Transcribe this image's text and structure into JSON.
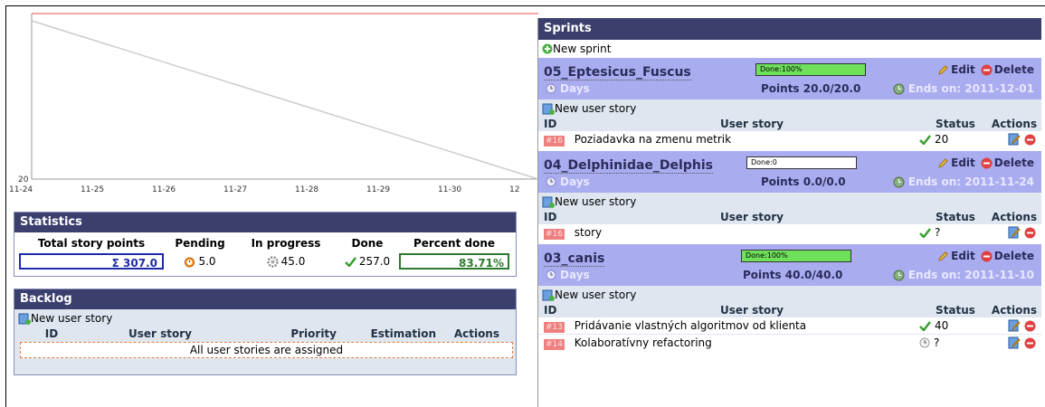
{
  "chart": {
    "x_labels": [
      "11-24",
      "11-25",
      "11-26",
      "11-27",
      "11-28",
      "11-29",
      "11-30",
      "12"
    ],
    "y_label_min": "20"
  },
  "statistics": {
    "title": "Statistics",
    "headers": [
      "Total story points",
      "Pending",
      "In progress",
      "Done",
      "Percent done"
    ],
    "total": "Σ 307.0",
    "pending": "5.0",
    "in_progress": "45.0",
    "done": "257.0",
    "percent": "83.71%"
  },
  "backlog": {
    "title": "Backlog",
    "new_user_story": "New user story",
    "headers": [
      "ID",
      "User story",
      "Priority",
      "Estimation",
      "Actions"
    ],
    "empty_message": "All user stories are assigned"
  },
  "sprints": {
    "title": "Sprints",
    "new_sprint": "New sprint",
    "items": [
      {
        "name": "05_Eptesicus_Fuscus",
        "progress_label": "Done:100%",
        "progress": 1.0,
        "edit": "Edit",
        "delete": "Delete",
        "days": "Days",
        "points": "Points 20.0/20.0",
        "ends": "Ends on: 2011-12-01",
        "new_user_story": "New user story",
        "headers": [
          "ID",
          "User story",
          "Status",
          "Actions"
        ],
        "stories": [
          {
            "id": "#16",
            "title": "Poziadavka na zmenu metrik",
            "status": "20",
            "status_icon": "check-icon"
          }
        ]
      },
      {
        "name": "04_Delphinidae_Delphis",
        "progress_label": "Done:0",
        "progress": 0.0,
        "edit": "Edit",
        "delete": "Delete",
        "days": "Days",
        "points": "Points 0.0/0.0",
        "ends": "Ends on: 2011-11-24",
        "new_user_story": "New user story",
        "headers": [
          "ID",
          "User story",
          "Status",
          "Actions"
        ],
        "stories": [
          {
            "id": "#16",
            "title": "story",
            "status": "?",
            "status_icon": "check-icon"
          }
        ]
      },
      {
        "name": "03_canis",
        "progress_label": "Done:100%",
        "progress": 1.0,
        "edit": "Edit",
        "delete": "Delete",
        "days": "Days",
        "points": "Points 40.0/40.0",
        "ends": "Ends on: 2011-11-10",
        "new_user_story": "New user story",
        "headers": [
          "ID",
          "User story",
          "Status",
          "Actions"
        ],
        "stories": [
          {
            "id": "#13",
            "title": "Pridávanie vlastných algoritmov od klienta",
            "status": "40",
            "status_icon": "check-icon"
          },
          {
            "id": "#14",
            "title": "Kolaboratívny refactoring",
            "status": "?",
            "status_icon": "clock-icon"
          }
        ]
      }
    ]
  }
}
